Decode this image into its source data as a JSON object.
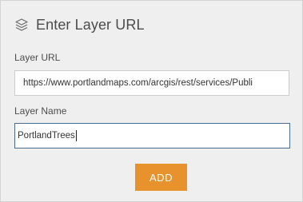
{
  "header": {
    "icon": "layers-icon",
    "title": "Enter Layer URL"
  },
  "form": {
    "url_label": "Layer URL",
    "url_value": "https://www.portlandmaps.com/arcgis/rest/services/Publi",
    "name_label": "Layer Name",
    "name_value": "PortlandTrees",
    "add_label": "ADD"
  },
  "colors": {
    "panel_bg": "#efefef",
    "accent": "#e8922e",
    "focus_border": "#4a6c8c",
    "text": "#4c4c4c"
  }
}
